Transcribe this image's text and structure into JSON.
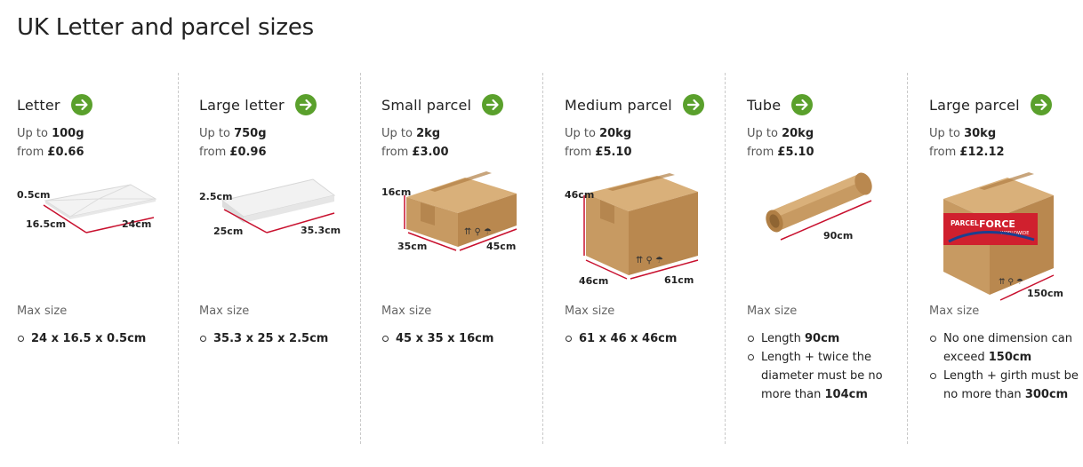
{
  "page": {
    "title": "UK Letter and parcel sizes"
  },
  "labels": {
    "up_to": "Up to",
    "from": "from",
    "max_size": "Max size"
  },
  "columns": [
    {
      "title": "Letter",
      "weight": "100g",
      "price": "£0.66",
      "dims": [
        "0.5cm",
        "16.5cm",
        "24cm"
      ],
      "max": [
        {
          "text": "24 x 16.5 x 0.5cm"
        }
      ]
    },
    {
      "title": "Large letter",
      "weight": "750g",
      "price": "£0.96",
      "dims": [
        "2.5cm",
        "25cm",
        "35.3cm"
      ],
      "max": [
        {
          "text": "35.3 x 25 x 2.5cm"
        }
      ]
    },
    {
      "title": "Small parcel",
      "weight": "2kg",
      "price": "£3.00",
      "dims": [
        "16cm",
        "35cm",
        "45cm"
      ],
      "max": [
        {
          "text": "45 x 35 x 16cm"
        }
      ]
    },
    {
      "title": "Medium parcel",
      "weight": "20kg",
      "price": "£5.10",
      "dims": [
        "46cm",
        "46cm",
        "61cm"
      ],
      "max": [
        {
          "text": "61 x 46 x 46cm"
        }
      ]
    },
    {
      "title": "Tube",
      "weight": "20kg",
      "price": "£5.10",
      "dims": [
        "90cm"
      ],
      "max": [
        {
          "pre": "Length ",
          "bold": "90cm"
        },
        {
          "pre": "Length + twice the diameter must be no more than ",
          "bold": "104cm"
        }
      ]
    },
    {
      "title": "Large parcel",
      "weight": "30kg",
      "price": "£12.12",
      "dims": [
        "150cm"
      ],
      "logo_text": [
        "PARCEL",
        "FORCE",
        "WORLDWIDE"
      ],
      "max": [
        {
          "pre": "No one dimension can exceed ",
          "bold": "150cm"
        },
        {
          "pre": "Length + girth must be no more than ",
          "bold": "300cm"
        }
      ]
    }
  ],
  "colors": {
    "accent_green": "#5aa02c",
    "dimension_red": "#c8102e",
    "cardboard": "#c79a62"
  },
  "icons": {
    "arrow": "arrow-right-icon"
  }
}
